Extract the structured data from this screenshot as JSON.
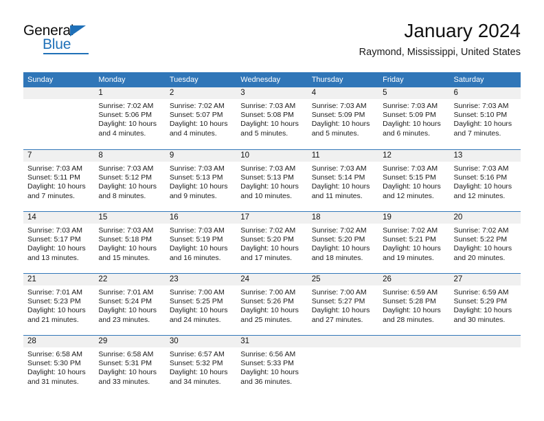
{
  "brand": {
    "name_top": "General",
    "name_bottom": "Blue",
    "triangle_color": "#1f70b8",
    "accent_color": "#1f70b8"
  },
  "header": {
    "title": "January 2024",
    "subtitle": "Raymond, Mississippi, United States"
  },
  "calendar": {
    "header_bg": "#3076b8",
    "header_text_color": "#ffffff",
    "day_band_bg": "#f0f0f0",
    "row_divider_color": "#3076b8",
    "weekdays": [
      "Sunday",
      "Monday",
      "Tuesday",
      "Wednesday",
      "Thursday",
      "Friday",
      "Saturday"
    ],
    "weeks": [
      [
        {
          "day": "",
          "sunrise": "",
          "sunset": "",
          "daylight_line1": "",
          "daylight_line2": ""
        },
        {
          "day": "1",
          "sunrise": "Sunrise: 7:02 AM",
          "sunset": "Sunset: 5:06 PM",
          "daylight_line1": "Daylight: 10 hours",
          "daylight_line2": "and 4 minutes."
        },
        {
          "day": "2",
          "sunrise": "Sunrise: 7:02 AM",
          "sunset": "Sunset: 5:07 PM",
          "daylight_line1": "Daylight: 10 hours",
          "daylight_line2": "and 4 minutes."
        },
        {
          "day": "3",
          "sunrise": "Sunrise: 7:03 AM",
          "sunset": "Sunset: 5:08 PM",
          "daylight_line1": "Daylight: 10 hours",
          "daylight_line2": "and 5 minutes."
        },
        {
          "day": "4",
          "sunrise": "Sunrise: 7:03 AM",
          "sunset": "Sunset: 5:09 PM",
          "daylight_line1": "Daylight: 10 hours",
          "daylight_line2": "and 5 minutes."
        },
        {
          "day": "5",
          "sunrise": "Sunrise: 7:03 AM",
          "sunset": "Sunset: 5:09 PM",
          "daylight_line1": "Daylight: 10 hours",
          "daylight_line2": "and 6 minutes."
        },
        {
          "day": "6",
          "sunrise": "Sunrise: 7:03 AM",
          "sunset": "Sunset: 5:10 PM",
          "daylight_line1": "Daylight: 10 hours",
          "daylight_line2": "and 7 minutes."
        }
      ],
      [
        {
          "day": "7",
          "sunrise": "Sunrise: 7:03 AM",
          "sunset": "Sunset: 5:11 PM",
          "daylight_line1": "Daylight: 10 hours",
          "daylight_line2": "and 7 minutes."
        },
        {
          "day": "8",
          "sunrise": "Sunrise: 7:03 AM",
          "sunset": "Sunset: 5:12 PM",
          "daylight_line1": "Daylight: 10 hours",
          "daylight_line2": "and 8 minutes."
        },
        {
          "day": "9",
          "sunrise": "Sunrise: 7:03 AM",
          "sunset": "Sunset: 5:13 PM",
          "daylight_line1": "Daylight: 10 hours",
          "daylight_line2": "and 9 minutes."
        },
        {
          "day": "10",
          "sunrise": "Sunrise: 7:03 AM",
          "sunset": "Sunset: 5:13 PM",
          "daylight_line1": "Daylight: 10 hours",
          "daylight_line2": "and 10 minutes."
        },
        {
          "day": "11",
          "sunrise": "Sunrise: 7:03 AM",
          "sunset": "Sunset: 5:14 PM",
          "daylight_line1": "Daylight: 10 hours",
          "daylight_line2": "and 11 minutes."
        },
        {
          "day": "12",
          "sunrise": "Sunrise: 7:03 AM",
          "sunset": "Sunset: 5:15 PM",
          "daylight_line1": "Daylight: 10 hours",
          "daylight_line2": "and 12 minutes."
        },
        {
          "day": "13",
          "sunrise": "Sunrise: 7:03 AM",
          "sunset": "Sunset: 5:16 PM",
          "daylight_line1": "Daylight: 10 hours",
          "daylight_line2": "and 12 minutes."
        }
      ],
      [
        {
          "day": "14",
          "sunrise": "Sunrise: 7:03 AM",
          "sunset": "Sunset: 5:17 PM",
          "daylight_line1": "Daylight: 10 hours",
          "daylight_line2": "and 13 minutes."
        },
        {
          "day": "15",
          "sunrise": "Sunrise: 7:03 AM",
          "sunset": "Sunset: 5:18 PM",
          "daylight_line1": "Daylight: 10 hours",
          "daylight_line2": "and 15 minutes."
        },
        {
          "day": "16",
          "sunrise": "Sunrise: 7:03 AM",
          "sunset": "Sunset: 5:19 PM",
          "daylight_line1": "Daylight: 10 hours",
          "daylight_line2": "and 16 minutes."
        },
        {
          "day": "17",
          "sunrise": "Sunrise: 7:02 AM",
          "sunset": "Sunset: 5:20 PM",
          "daylight_line1": "Daylight: 10 hours",
          "daylight_line2": "and 17 minutes."
        },
        {
          "day": "18",
          "sunrise": "Sunrise: 7:02 AM",
          "sunset": "Sunset: 5:20 PM",
          "daylight_line1": "Daylight: 10 hours",
          "daylight_line2": "and 18 minutes."
        },
        {
          "day": "19",
          "sunrise": "Sunrise: 7:02 AM",
          "sunset": "Sunset: 5:21 PM",
          "daylight_line1": "Daylight: 10 hours",
          "daylight_line2": "and 19 minutes."
        },
        {
          "day": "20",
          "sunrise": "Sunrise: 7:02 AM",
          "sunset": "Sunset: 5:22 PM",
          "daylight_line1": "Daylight: 10 hours",
          "daylight_line2": "and 20 minutes."
        }
      ],
      [
        {
          "day": "21",
          "sunrise": "Sunrise: 7:01 AM",
          "sunset": "Sunset: 5:23 PM",
          "daylight_line1": "Daylight: 10 hours",
          "daylight_line2": "and 21 minutes."
        },
        {
          "day": "22",
          "sunrise": "Sunrise: 7:01 AM",
          "sunset": "Sunset: 5:24 PM",
          "daylight_line1": "Daylight: 10 hours",
          "daylight_line2": "and 23 minutes."
        },
        {
          "day": "23",
          "sunrise": "Sunrise: 7:00 AM",
          "sunset": "Sunset: 5:25 PM",
          "daylight_line1": "Daylight: 10 hours",
          "daylight_line2": "and 24 minutes."
        },
        {
          "day": "24",
          "sunrise": "Sunrise: 7:00 AM",
          "sunset": "Sunset: 5:26 PM",
          "daylight_line1": "Daylight: 10 hours",
          "daylight_line2": "and 25 minutes."
        },
        {
          "day": "25",
          "sunrise": "Sunrise: 7:00 AM",
          "sunset": "Sunset: 5:27 PM",
          "daylight_line1": "Daylight: 10 hours",
          "daylight_line2": "and 27 minutes."
        },
        {
          "day": "26",
          "sunrise": "Sunrise: 6:59 AM",
          "sunset": "Sunset: 5:28 PM",
          "daylight_line1": "Daylight: 10 hours",
          "daylight_line2": "and 28 minutes."
        },
        {
          "day": "27",
          "sunrise": "Sunrise: 6:59 AM",
          "sunset": "Sunset: 5:29 PM",
          "daylight_line1": "Daylight: 10 hours",
          "daylight_line2": "and 30 minutes."
        }
      ],
      [
        {
          "day": "28",
          "sunrise": "Sunrise: 6:58 AM",
          "sunset": "Sunset: 5:30 PM",
          "daylight_line1": "Daylight: 10 hours",
          "daylight_line2": "and 31 minutes."
        },
        {
          "day": "29",
          "sunrise": "Sunrise: 6:58 AM",
          "sunset": "Sunset: 5:31 PM",
          "daylight_line1": "Daylight: 10 hours",
          "daylight_line2": "and 33 minutes."
        },
        {
          "day": "30",
          "sunrise": "Sunrise: 6:57 AM",
          "sunset": "Sunset: 5:32 PM",
          "daylight_line1": "Daylight: 10 hours",
          "daylight_line2": "and 34 minutes."
        },
        {
          "day": "31",
          "sunrise": "Sunrise: 6:56 AM",
          "sunset": "Sunset: 5:33 PM",
          "daylight_line1": "Daylight: 10 hours",
          "daylight_line2": "and 36 minutes."
        },
        {
          "day": "",
          "sunrise": "",
          "sunset": "",
          "daylight_line1": "",
          "daylight_line2": ""
        },
        {
          "day": "",
          "sunrise": "",
          "sunset": "",
          "daylight_line1": "",
          "daylight_line2": ""
        },
        {
          "day": "",
          "sunrise": "",
          "sunset": "",
          "daylight_line1": "",
          "daylight_line2": ""
        }
      ]
    ]
  }
}
